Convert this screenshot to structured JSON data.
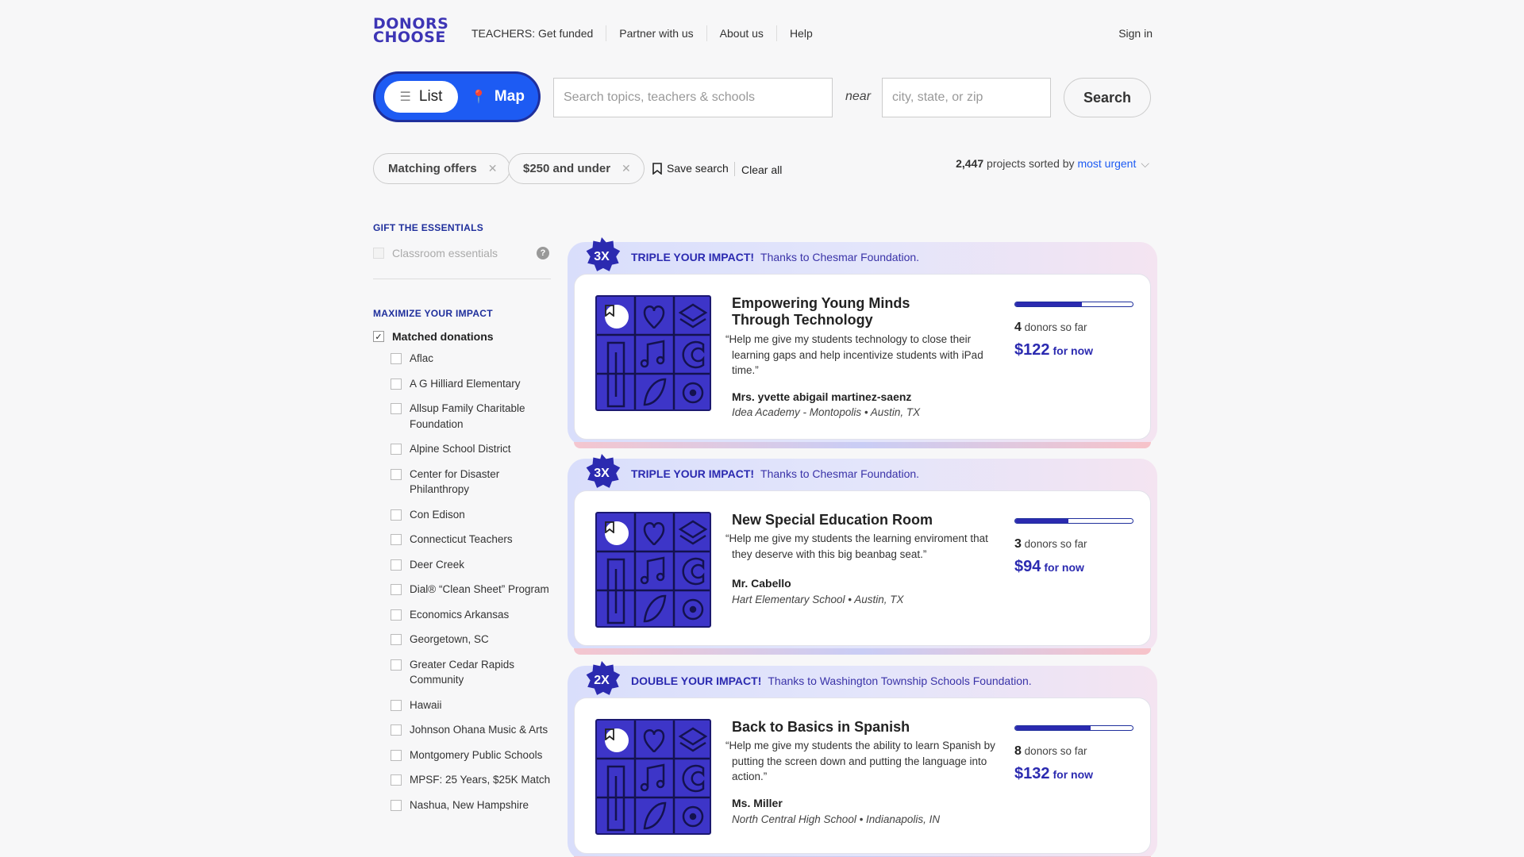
{
  "header": {
    "logo_line1": "DONORS",
    "logo_line2": "CHOOSE",
    "nav": [
      "TEACHERS: Get funded",
      "Partner with us",
      "About us",
      "Help"
    ],
    "signin": "Sign in"
  },
  "search": {
    "list_label": "List",
    "map_label": "Map",
    "query_placeholder": "Search topics, teachers & schools",
    "near_label": "near",
    "location_placeholder": "city, state, or zip",
    "button_label": "Search"
  },
  "filters": {
    "chips": [
      "Matching offers",
      "$250 and under"
    ],
    "save_search": "Save search",
    "clear_all": "Clear all",
    "count": "2,447",
    "sorted_by_text": "projects sorted by",
    "sort_value": "most urgent"
  },
  "sidebar": {
    "gift_heading": "GIFT THE ESSENTIALS",
    "essentials_label": "Classroom essentials",
    "maximize_heading": "MAXIMIZE YOUR IMPACT",
    "matched_label": "Matched donations",
    "partners": [
      "Aflac",
      "A G Hilliard Elementary",
      "Allsup Family Charitable Foundation",
      "Alpine School District",
      "Center for Disaster Philanthropy",
      "Con Edison",
      "Connecticut Teachers",
      "Deer Creek",
      "Dial® “Clean Sheet” Program",
      "Economics Arkansas",
      "Georgetown, SC",
      "Greater Cedar Rapids Community",
      "Hawaii",
      "Johnson Ohana Music & Arts",
      "Montgomery Public Schools",
      "MPSF: 25 Years, $25K Match",
      "Nashua, New Hampshire"
    ]
  },
  "colors": {
    "brand": "#3d35b5",
    "accent_blue": "#1d5bf3",
    "impact_text": "#2b2ab0"
  },
  "projects": [
    {
      "multiplier": "3X",
      "impact_label": "TRIPLE YOUR IMPACT!",
      "thanks": "Thanks to Chesmar Foundation.",
      "title": "Empowering Young Minds Through Technology",
      "quote": "“Help me give my students technology to close their learning gaps and help incentivize students with iPad time.”",
      "teacher": "Mrs. yvette abigail martinez-saenz",
      "school": "Idea Academy - Montopolis • Austin, TX",
      "donors_count": "4",
      "donors_text": "donors so far",
      "amount": "$122",
      "for_now": "for now",
      "progress": 0.57
    },
    {
      "multiplier": "3X",
      "impact_label": "TRIPLE YOUR IMPACT!",
      "thanks": "Thanks to Chesmar Foundation.",
      "title": "New Special Education Room",
      "quote": "“Help me give my students the learning enviroment that they deserve with this big beanbag seat.”",
      "teacher": "Mr. Cabello",
      "school": "Hart Elementary School • Austin, TX",
      "donors_count": "3",
      "donors_text": "donors so far",
      "amount": "$94",
      "for_now": "for now",
      "progress": 0.45
    },
    {
      "multiplier": "2X",
      "impact_label": "DOUBLE YOUR IMPACT!",
      "thanks": "Thanks to Washington Township Schools Foundation.",
      "title": "Back to Basics in Spanish",
      "quote": "“Help me give my students the ability to learn Spanish by putting the screen down and putting the language into action.”",
      "teacher": "Ms. Miller",
      "school": "North Central High School • Indianapolis, IN",
      "donors_count": "8",
      "donors_text": "donors so far",
      "amount": "$132",
      "for_now": "for now",
      "progress": 0.64
    }
  ]
}
